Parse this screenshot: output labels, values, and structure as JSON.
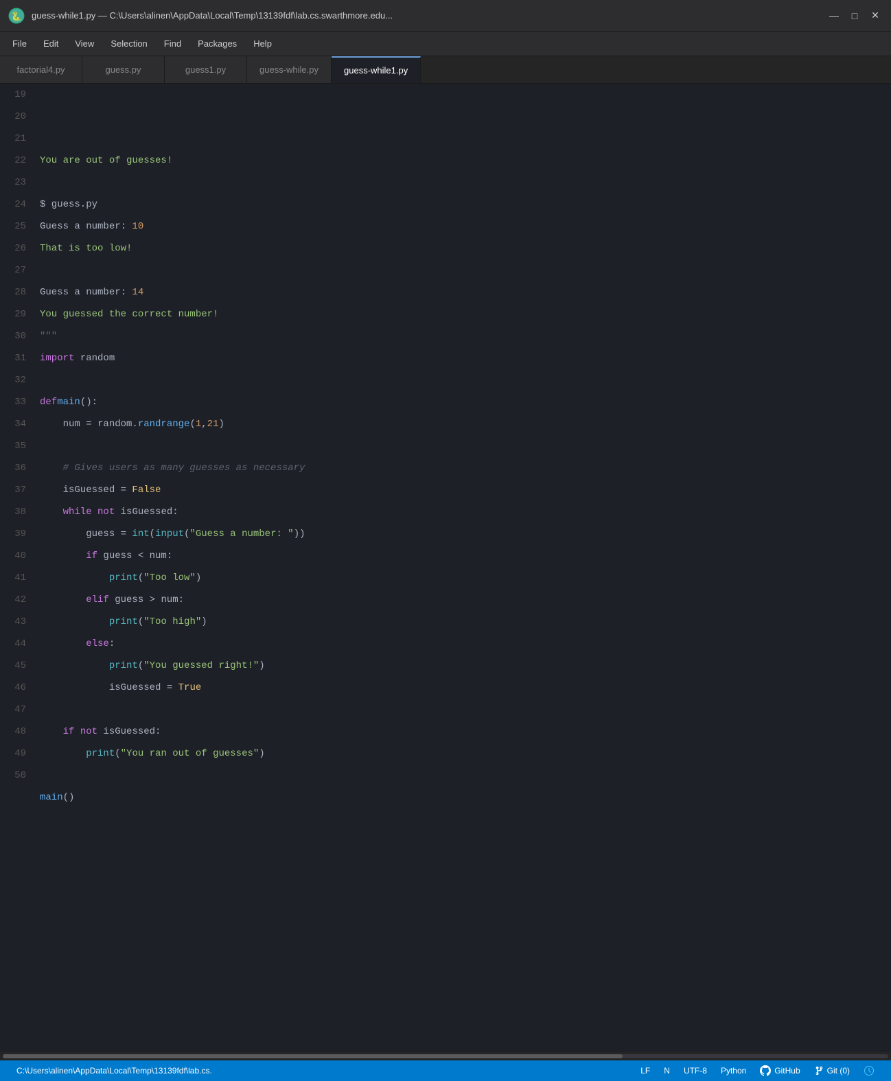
{
  "titleBar": {
    "title": "guess-while1.py — C:\\Users\\alinen\\AppData\\Local\\Temp\\13139fdf\\lab.cs.swarthmore.edu...",
    "appIcon": "🐍",
    "minimizeLabel": "—",
    "maximizeLabel": "□",
    "closeLabel": "✕"
  },
  "menuBar": {
    "items": [
      "File",
      "Edit",
      "View",
      "Selection",
      "Find",
      "Packages",
      "Help"
    ]
  },
  "tabs": [
    {
      "id": "factorial4",
      "label": "factorial4.py",
      "active": false
    },
    {
      "id": "guess",
      "label": "guess.py",
      "active": false
    },
    {
      "id": "guess1",
      "label": "guess1.py",
      "active": false
    },
    {
      "id": "guess-while",
      "label": "guess-while.py",
      "active": false
    },
    {
      "id": "guess-while1",
      "label": "guess-while1.py",
      "active": true
    }
  ],
  "statusBar": {
    "path": "C:\\Users\\alinen\\AppData\\Local\\Temp\\13139fdf\\lab.cs.",
    "lineEnding": "LF",
    "indentation": "N",
    "encoding": "UTF-8",
    "language": "Python",
    "githubLabel": "GitHub",
    "gitLabel": "Git (0)"
  },
  "lineNumbers": [
    19,
    20,
    21,
    22,
    23,
    24,
    25,
    26,
    27,
    28,
    29,
    30,
    31,
    32,
    33,
    34,
    35,
    36,
    37,
    38,
    39,
    40,
    41,
    42,
    43,
    44,
    45,
    46,
    47,
    48,
    49,
    50
  ]
}
